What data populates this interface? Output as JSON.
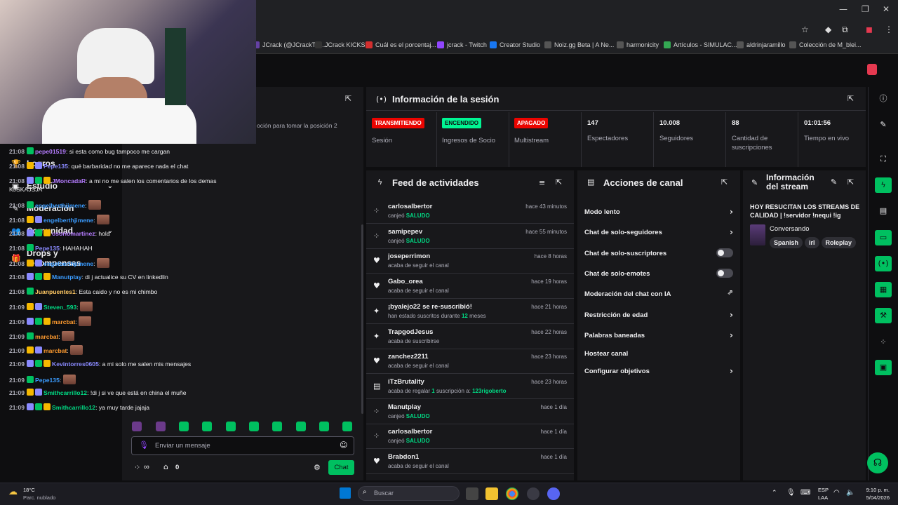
{
  "browser": {
    "bookmarks": [
      {
        "label": "JCrack (@JCrackTV)...",
        "color": "#6441a5"
      },
      {
        "label": "JCrack KICKS",
        "color": "#333"
      },
      {
        "label": "Cuál es el porcentaj...",
        "color": "#d32f2f"
      },
      {
        "label": "jcrack - Twitch",
        "color": "#9146ff"
      },
      {
        "label": "Creator Studio",
        "color": "#1877f2"
      },
      {
        "label": "Noiz.gg Beta | A Ne...",
        "color": "#555"
      },
      {
        "label": "harmonicity",
        "color": "#555"
      },
      {
        "label": "Artículos - SIMULAC...",
        "color": "#34a853"
      },
      {
        "label": "aldrinjaramillo",
        "color": "#555"
      },
      {
        "label": "Colección de M_blei...",
        "color": "#555"
      }
    ]
  },
  "leftnav": {
    "items": [
      {
        "icon": "trophy-icon",
        "glyph": "🏆",
        "label": "Logros"
      },
      {
        "icon": "studio-icon",
        "glyph": "▣",
        "label": "Estudio",
        "chevron": "⌄"
      },
      {
        "icon": "wrench-icon",
        "glyph": "✎",
        "label": "Moderación"
      },
      {
        "icon": "community-icon",
        "glyph": "👥",
        "label": "Comunidad",
        "chevron": "⌄"
      },
      {
        "icon": "gift-icon",
        "glyph": "🎁",
        "label": "Drops y recompensas"
      }
    ]
  },
  "chat": {
    "hint": "oción para tomar la posición 2",
    "messages": [
      {
        "time": "21:08",
        "user": "pepe01519",
        "color": "#b57cff",
        "text": ": si esta como bug tampoco me cargan"
      },
      {
        "time": "21:08",
        "user": "Pepe135",
        "color": "#8a8aff",
        "text": ": qué barbaridad no me aparece nada el chat"
      },
      {
        "time": "21:08",
        "user": "JMoncadaR",
        "color": "#b57cff",
        "text": ": a mi no me salen los comentarios de los demas KJSKAJSJA"
      },
      {
        "time": "21:08",
        "user": "engelberthjimene",
        "color": "#3b9cff",
        "text": ":"
      },
      {
        "time": "21:08",
        "user": "engelberthjimene",
        "color": "#3b9cff",
        "text": ":"
      },
      {
        "time": "21:08",
        "user": "osoriomartinez",
        "color": "#b57cff",
        "text": ": hola"
      },
      {
        "time": "21:08",
        "user": "Pepe135",
        "color": "#8a8aff",
        "text": ": HAHAHAH"
      },
      {
        "time": "21:08",
        "user": "engelberthjimene",
        "color": "#3b9cff",
        "text": ":"
      },
      {
        "time": "21:08",
        "user": "Manutplay",
        "color": "#3b9cff",
        "text": ": di j actualice su CV en linkedlin"
      },
      {
        "time": "21:08",
        "user": "Juanpuentes1",
        "color": "#ffc864",
        "text": ": Esta caido y no es mi chimbo"
      },
      {
        "time": "21:09",
        "user": "Steven_593",
        "color": "#00db84",
        "text": ":"
      },
      {
        "time": "21:09",
        "user": "marcbat",
        "color": "#ff9b2f",
        "text": ":"
      },
      {
        "time": "21:09",
        "user": "marcbat",
        "color": "#ff9b2f",
        "text": ":"
      },
      {
        "time": "21:09",
        "user": "marcbat",
        "color": "#ff9b2f",
        "text": ":"
      },
      {
        "time": "21:09",
        "user": "Kevintorres0605",
        "color": "#8a8aff",
        "text": ": a mi solo me salen mis mensajes"
      },
      {
        "time": "21:09",
        "user": "Pepe135",
        "color": "#3b9cff",
        "text": ":"
      },
      {
        "time": "21:09",
        "user": "Smithcarrillo12",
        "color": "#00db84",
        "text": ": !di j si ve que está en china el muñe"
      },
      {
        "time": "21:09",
        "user": "Smithcarrillo12",
        "color": "#00db84",
        "text": ": ya muy tarde jajaja"
      }
    ],
    "input_placeholder": "Enviar un mensaje",
    "points": "∞",
    "store_count": "0",
    "send_label": "Chat"
  },
  "session": {
    "title": "Información de la sesión",
    "stats": [
      {
        "pill": "TRANSMITIENDO",
        "pill_bg": "#eb0400",
        "pill_fg": "#ffffff",
        "label": "Sesión"
      },
      {
        "pill": "ENCENDIDO",
        "pill_bg": "#00f593",
        "pill_fg": "#0e0e10",
        "label": "Ingresos de Socio"
      },
      {
        "pill": "APAGADO",
        "pill_bg": "#eb0400",
        "pill_fg": "#ffffff",
        "label": "Multistream"
      },
      {
        "num": "147",
        "label": "Espectadores"
      },
      {
        "num": "10.008",
        "label": "Seguidores"
      },
      {
        "num": "88",
        "label": "Cantidad de suscripciones"
      },
      {
        "num": "01:01:56",
        "label": "Tiempo en vivo"
      }
    ]
  },
  "feed": {
    "title": "Feed de actividades",
    "items": [
      {
        "icon": "points-icon",
        "glyph": "⁘",
        "name": "carlosalbertor",
        "sub": "canjeó ",
        "hl": "SALUDO",
        "time": "hace 43 minutos"
      },
      {
        "icon": "points-icon",
        "glyph": "⁘",
        "name": "samipepev",
        "sub": "canjeó ",
        "hl": "SALUDO",
        "time": "hace 55 minutos"
      },
      {
        "icon": "heart-icon",
        "glyph": "♥",
        "name": "joseperrimon",
        "sub": "acaba de seguir el canal",
        "hl": "",
        "time": "hace 8 horas"
      },
      {
        "icon": "heart-icon",
        "glyph": "♥",
        "name": "Gabo_orea",
        "sub": "acaba de seguir el canal",
        "hl": "",
        "time": "hace 19 horas"
      },
      {
        "icon": "star-icon",
        "glyph": "✦",
        "name": "¡byalejo22 se re-suscribió!",
        "sub": "han estado suscritos durante ",
        "hl": "12",
        "tail": " meses",
        "time": "hace 21 horas"
      },
      {
        "icon": "star-icon",
        "glyph": "✦",
        "name": "TrapgodJesus",
        "sub": "acaba de suscribirse",
        "hl": "",
        "time": "hace 22 horas"
      },
      {
        "icon": "heart-icon",
        "glyph": "♥",
        "name": "zanchez2211",
        "sub": "acaba de seguir el canal",
        "hl": "",
        "time": "hace 23 horas"
      },
      {
        "icon": "gift-icon",
        "glyph": "▤",
        "name": "iTzBrutality",
        "sub": "acaba de regalar ",
        "hl": "1",
        "tail": " suscripción a: ",
        "hl2": "123rigoberto",
        "time": "hace 23 horas"
      },
      {
        "icon": "points-icon",
        "glyph": "⁘",
        "name": "Manutplay",
        "sub": "canjeó ",
        "hl": "SALUDO",
        "time": "hace 1 día"
      },
      {
        "icon": "points-icon",
        "glyph": "⁘",
        "name": "carlosalbertor",
        "sub": "canjeó ",
        "hl": "SALUDO",
        "time": "hace 1 día"
      },
      {
        "icon": "heart-icon",
        "glyph": "♥",
        "name": "Brabdon1",
        "sub": "acaba de seguir el canal",
        "hl": "",
        "time": "hace 1 día"
      }
    ]
  },
  "actions": {
    "title": "Acciones de canal",
    "items": [
      {
        "label": "Modo lento",
        "control": "chevron"
      },
      {
        "label": "Chat de solo-seguidores",
        "control": "chevron"
      },
      {
        "label": "Chat de solo-suscriptores",
        "control": "toggle"
      },
      {
        "label": "Chat de solo-emotes",
        "control": "toggle"
      },
      {
        "label": "Moderación del chat con IA",
        "control": "external"
      },
      {
        "label": "Restricción de edad",
        "control": "chevron"
      },
      {
        "label": "Palabras baneadas",
        "control": "chevron"
      },
      {
        "label": "Hostear canal",
        "control": "none"
      },
      {
        "label": "Configurar objetivos",
        "control": "chevron"
      }
    ]
  },
  "stream_info": {
    "title": "Información del stream",
    "stream_title": "HOY RESUCITAN LOS STREAMS DE CALIDAD | !servidor !nequi !ig",
    "category": "Conversando",
    "tags": [
      "Spanish",
      "irl",
      "Roleplay"
    ]
  },
  "taskbar": {
    "weather_temp": "18°C",
    "weather_desc": "Parc. nublado",
    "search_placeholder": "Buscar",
    "lang": "ESP",
    "lang2": "LAA",
    "time": "9:10 p. m.",
    "date": "5/04/2026"
  },
  "colors": {
    "accent": "#00c060",
    "live": "#eb0400"
  }
}
